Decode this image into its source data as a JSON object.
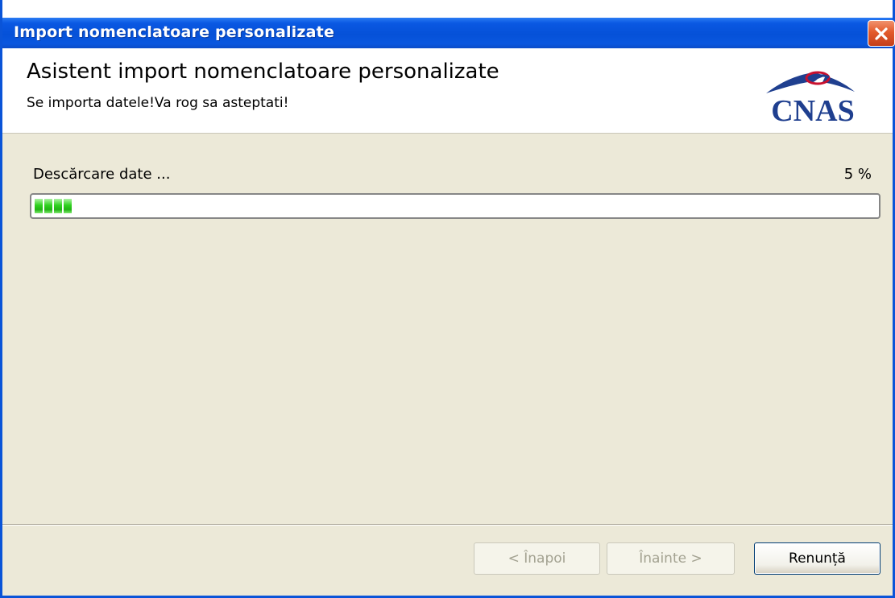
{
  "window": {
    "title": "Import nomenclatoare personalizate"
  },
  "header": {
    "title": "Asistent import nomenclatoare personalizate",
    "subtitle": "Se importa datele!Va rog sa asteptati!",
    "logo_text": "CNAS"
  },
  "progress": {
    "label": "Descărcare date ...",
    "percent_text": "5 %",
    "value": 5
  },
  "buttons": {
    "back": "< Înapoi",
    "next": "Înainte >",
    "cancel": "Renunță"
  },
  "colors": {
    "titlebar": "#0551d8",
    "close": "#e35a2b",
    "progress_green": "#2fd11f",
    "logo_blue": "#1f3f8f",
    "logo_red": "#c8102e",
    "dialog_bg": "#ece9d8"
  }
}
